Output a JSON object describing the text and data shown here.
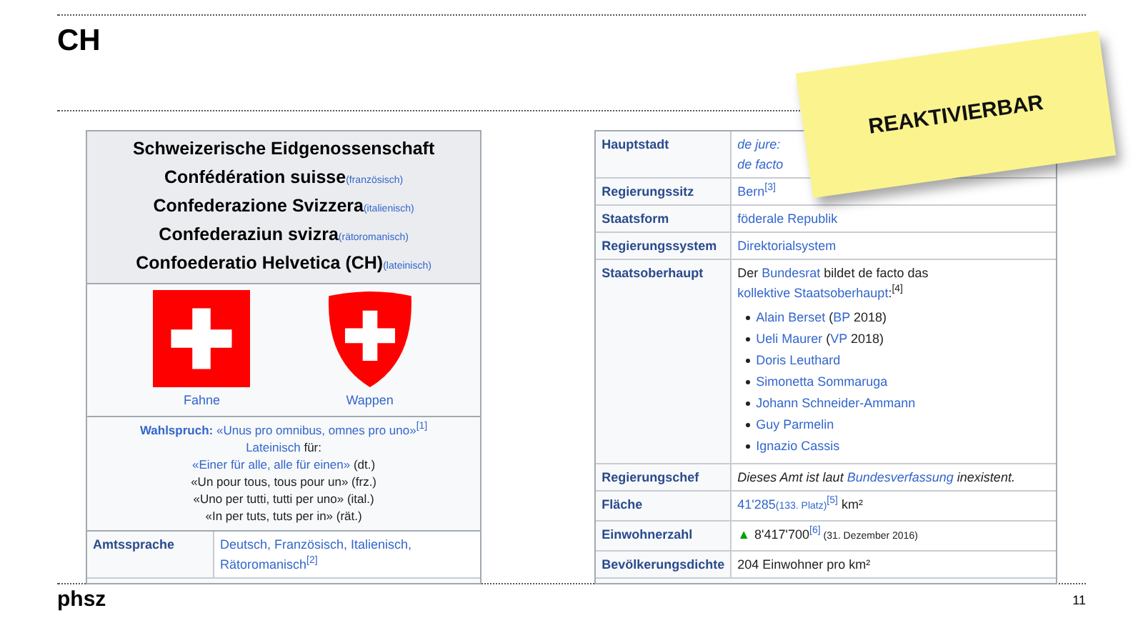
{
  "slide": {
    "title": "CH",
    "logo": "phsz",
    "page_number": "11"
  },
  "left_infobox": {
    "names": [
      {
        "name": "Schweizerische Eidgenossenschaft"
      },
      {
        "name": "Confédération suisse",
        "language": "(französisch)"
      },
      {
        "name": "Confederazione Svizzera",
        "language": "(italienisch)"
      },
      {
        "name": "Confederaziun svizra",
        "language": "(rätoromanisch)"
      },
      {
        "name": "Confoederatio Helvetica (CH)",
        "language": "(lateinisch)"
      }
    ],
    "emblems": [
      {
        "kind": "flag",
        "caption": "Fahne"
      },
      {
        "kind": "shield",
        "caption": "Wappen"
      }
    ],
    "motto": [
      [
        {
          "text": "**Wahlspruch:** «Unus pro omnibus, omnes pro uno»$^{[1]}$",
          "link": true
        }
      ],
      [
        {
          "text": "Lateinisch",
          "link": true
        },
        {
          "text": " für:",
          "link": false
        }
      ],
      [
        {
          "text": "«Einer für alle, alle für einen»",
          "link": true
        },
        {
          "text": " (dt.)",
          "link": false
        }
      ],
      [
        {
          "text": "«Un pour tous, tous pour un» (frz.)",
          "link": false
        }
      ],
      [
        {
          "text": "«Uno per tutti, tutti per uno» (ital.)",
          "link": false
        }
      ],
      [
        {
          "text": "«In per tuts, tuts per in» (rät.)",
          "link": false
        }
      ]
    ],
    "rows": [
      {
        "label": "Amtssprache",
        "paragraphs": [
          [
            {
              "text": "Deutsch, Französisch, Italienisch, Rätoromanisch$^{[2]}$",
              "link": true
            }
          ]
        ]
      }
    ]
  },
  "right_infobox": {
    "rows": [
      {
        "label": "Hauptstadt",
        "paragraphs": [
          [
            {
              "text": "*de jure:*",
              "link": true
            }
          ],
          [
            {
              "text": "*de facto*",
              "link": true
            }
          ]
        ]
      },
      {
        "label": "Regierungssitz",
        "paragraphs": [
          [
            {
              "text": "Bern$^{[3]}$",
              "link": true
            }
          ]
        ]
      },
      {
        "label": "Staatsform",
        "paragraphs": [
          [
            {
              "text": "föderale Republik",
              "link": true
            }
          ]
        ]
      },
      {
        "label": "Regierungssystem",
        "paragraphs": [
          [
            {
              "text": "Direktorialsystem",
              "link": true
            }
          ]
        ]
      },
      {
        "label": "Staatsoberhaupt",
        "paragraphs": [
          [
            {
              "text": "Der ",
              "link": false
            },
            {
              "text": "Bundesrat",
              "link": true
            },
            {
              "text": " bildet de facto das ",
              "link": false
            },
            {
              "text": "kollektive Staatsoberhaupt",
              "link": true
            },
            {
              "text": ":$^{[4]}$",
              "link": false
            }
          ]
        ],
        "list": [
          [
            {
              "text": "Alain Berset",
              "link": true
            },
            {
              "text": " (",
              "link": false
            },
            {
              "text": "BP",
              "link": true
            },
            {
              "text": " 2018)",
              "link": false
            }
          ],
          [
            {
              "text": "Ueli Maurer",
              "link": true
            },
            {
              "text": " (",
              "link": false
            },
            {
              "text": "VP",
              "link": true
            },
            {
              "text": " 2018)",
              "link": false
            }
          ],
          [
            {
              "text": "Doris Leuthard",
              "link": true
            }
          ],
          [
            {
              "text": "Simonetta Sommaruga",
              "link": true
            }
          ],
          [
            {
              "text": "Johann Schneider-Ammann",
              "link": true
            }
          ],
          [
            {
              "text": "Guy Parmelin",
              "link": true
            }
          ],
          [
            {
              "text": "Ignazio Cassis",
              "link": true
            }
          ]
        ]
      },
      {
        "label": "Regierungschef",
        "paragraphs": [
          [
            {
              "text": "*Dieses Amt ist laut* ",
              "link": false
            },
            {
              "text": "*Bundesverfassung*",
              "link": true
            },
            {
              "text": " *inexistent.*",
              "link": false
            }
          ]
        ]
      },
      {
        "label": "Fläche",
        "paragraphs": [
          [
            {
              "text": "41'285",
              "link": true
            },
            {
              "text": "(133. Platz)",
              "link": true,
              "small": true
            },
            {
              "text": "$^{[5]}$",
              "link": true
            },
            {
              "text": " km²",
              "link": false
            }
          ]
        ]
      },
      {
        "label": "Einwohnerzahl",
        "trend_icon": "▲",
        "paragraphs": [
          [
            {
              "text": "8'417'700",
              "link": false
            },
            {
              "text": "$^{[6]}$",
              "link": true
            },
            {
              "text": " (31. Dezember 2016)",
              "link": false,
              "small": true
            }
          ]
        ]
      },
      {
        "label": "Bevölkerungsdichte",
        "paragraphs": [
          [
            {
              "text": "204 Einwohner pro km²",
              "link": false
            }
          ]
        ]
      }
    ]
  },
  "sticky_note": {
    "text": "REAKTIVIERBAR"
  }
}
